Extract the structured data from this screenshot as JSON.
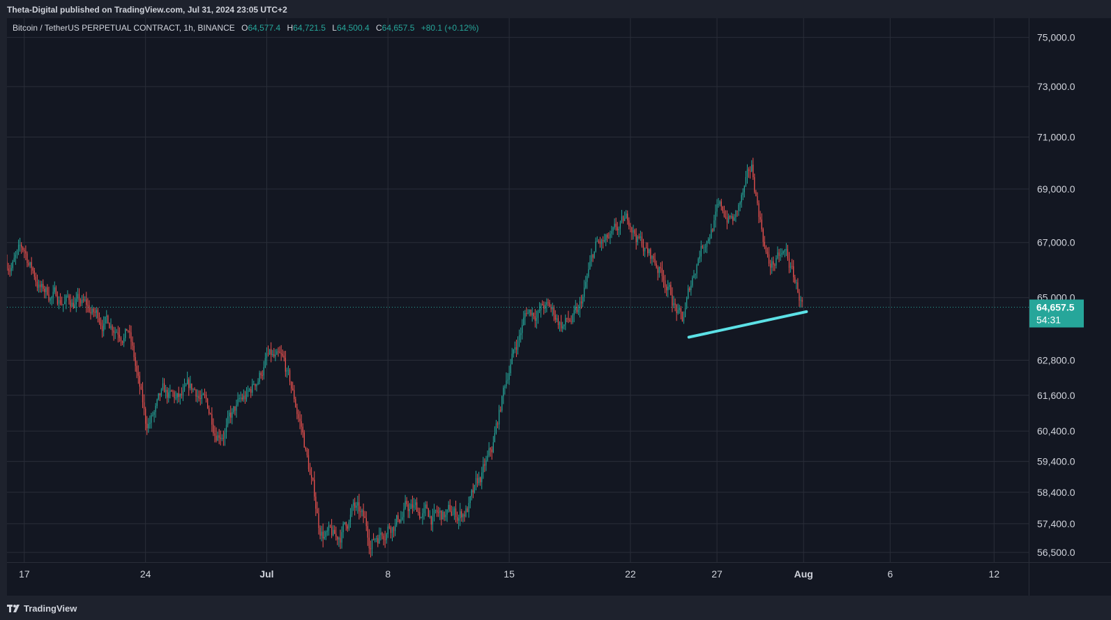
{
  "header": {
    "published": "Theta-Digital published on TradingView.com, Jul 31, 2024 23:05 UTC+2"
  },
  "legend": {
    "symbol": "Bitcoin / TetherUS PERPETUAL CONTRACT, 1h, BINANCE",
    "o_label": "O",
    "o_value": "64,577.4",
    "h_label": "H",
    "h_value": "64,721.5",
    "l_label": "L",
    "l_value": "64,500.4",
    "c_label": "C",
    "c_value": "64,657.5",
    "change": "+80.1 (+0.12%)"
  },
  "price_tag": {
    "price": "64,657.5",
    "countdown": "54:31"
  },
  "footer": {
    "brand": "TradingView"
  },
  "colors": {
    "background": "#131722",
    "frame": "#1e222d",
    "grid": "#2a2e39",
    "up": "#26a69a",
    "down": "#ef5350",
    "trendline": "#5ce1e6",
    "price_tag": "#26a69a",
    "axis_text": "#d1d4dc"
  },
  "chart_data": {
    "type": "candlestick",
    "symbol": "BTCUSDT.P",
    "timeframe": "1h",
    "x_ticks": [
      "17",
      "24",
      "Jul",
      "8",
      "15",
      "22",
      "27",
      "Aug",
      "6",
      "12"
    ],
    "y_ticks": [
      75000,
      73000,
      71000,
      69000,
      67000,
      65000,
      62800,
      61600,
      60400,
      59400,
      58400,
      57400,
      56500
    ],
    "y_tick_labels": [
      "75,000.0",
      "73,000.0",
      "71,000.0",
      "69,000.0",
      "67,000.0",
      "65,000.0",
      "62,800.0",
      "61,600.0",
      "60,400.0",
      "59,400.0",
      "58,400.0",
      "57,400.0",
      "56,500.0"
    ],
    "y_scale": "log",
    "y_range": [
      56200,
      75800
    ],
    "x_range": [
      "2024-06-16",
      "2024-08-14"
    ],
    "last_price": 64657.5,
    "price_path": [
      [
        "2024-06-16",
        66300
      ],
      [
        "2024-06-17",
        66600
      ],
      [
        "2024-06-18",
        65300
      ],
      [
        "2024-06-19",
        65000
      ],
      [
        "2024-06-20",
        64900
      ],
      [
        "2024-06-21",
        64300
      ],
      [
        "2024-06-22",
        64200
      ],
      [
        "2024-06-23",
        64100
      ],
      [
        "2024-06-24",
        60500
      ],
      [
        "2024-06-25",
        61300
      ],
      [
        "2024-06-26",
        61200
      ],
      [
        "2024-06-27",
        61600
      ],
      [
        "2024-06-28",
        60600
      ],
      [
        "2024-06-29",
        60900
      ],
      [
        "2024-06-30",
        61500
      ],
      [
        "2024-07-01",
        62900
      ],
      [
        "2024-07-02",
        62300
      ],
      [
        "2024-07-03",
        60500
      ],
      [
        "2024-07-04",
        57400
      ],
      [
        "2024-07-05",
        56700
      ],
      [
        "2024-07-06",
        57900
      ],
      [
        "2024-07-07",
        56800
      ],
      [
        "2024-07-08",
        57600
      ],
      [
        "2024-07-09",
        57900
      ],
      [
        "2024-07-10",
        57700
      ],
      [
        "2024-07-11",
        57500
      ],
      [
        "2024-07-12",
        57600
      ],
      [
        "2024-07-13",
        58200
      ],
      [
        "2024-07-14",
        59500
      ],
      [
        "2024-07-15",
        62600
      ],
      [
        "2024-07-16",
        64500
      ],
      [
        "2024-07-17",
        64700
      ],
      [
        "2024-07-18",
        64100
      ],
      [
        "2024-07-19",
        64200
      ],
      [
        "2024-07-20",
        66700
      ],
      [
        "2024-07-21",
        66900
      ],
      [
        "2024-07-22",
        67700
      ],
      [
        "2024-07-23",
        66600
      ],
      [
        "2024-07-24",
        65800
      ],
      [
        "2024-07-25",
        64000
      ],
      [
        "2024-07-26",
        66800
      ],
      [
        "2024-07-27",
        68200
      ],
      [
        "2024-07-28",
        67800
      ],
      [
        "2024-07-29",
        69500
      ],
      [
        "2024-07-30",
        66200
      ],
      [
        "2024-07-31",
        66400
      ],
      [
        "2024-07-31T23:00",
        64657.5
      ]
    ],
    "extremes": [
      [
        "2024-07-05",
        56500,
        "low"
      ],
      [
        "2024-07-06",
        58600,
        "high"
      ],
      [
        "2024-07-08",
        56400,
        "low"
      ],
      [
        "2024-07-09",
        59600,
        "high"
      ],
      [
        "2024-07-01",
        63500,
        "high"
      ],
      [
        "2024-06-24",
        58500,
        "low"
      ],
      [
        "2024-07-29",
        70000,
        "high"
      ],
      [
        "2024-07-25",
        63800,
        "low"
      ]
    ],
    "trendline": {
      "from": [
        "2024-07-25T09:00",
        63600
      ],
      "to": [
        "2024-08-01T04:00",
        64500
      ]
    }
  }
}
